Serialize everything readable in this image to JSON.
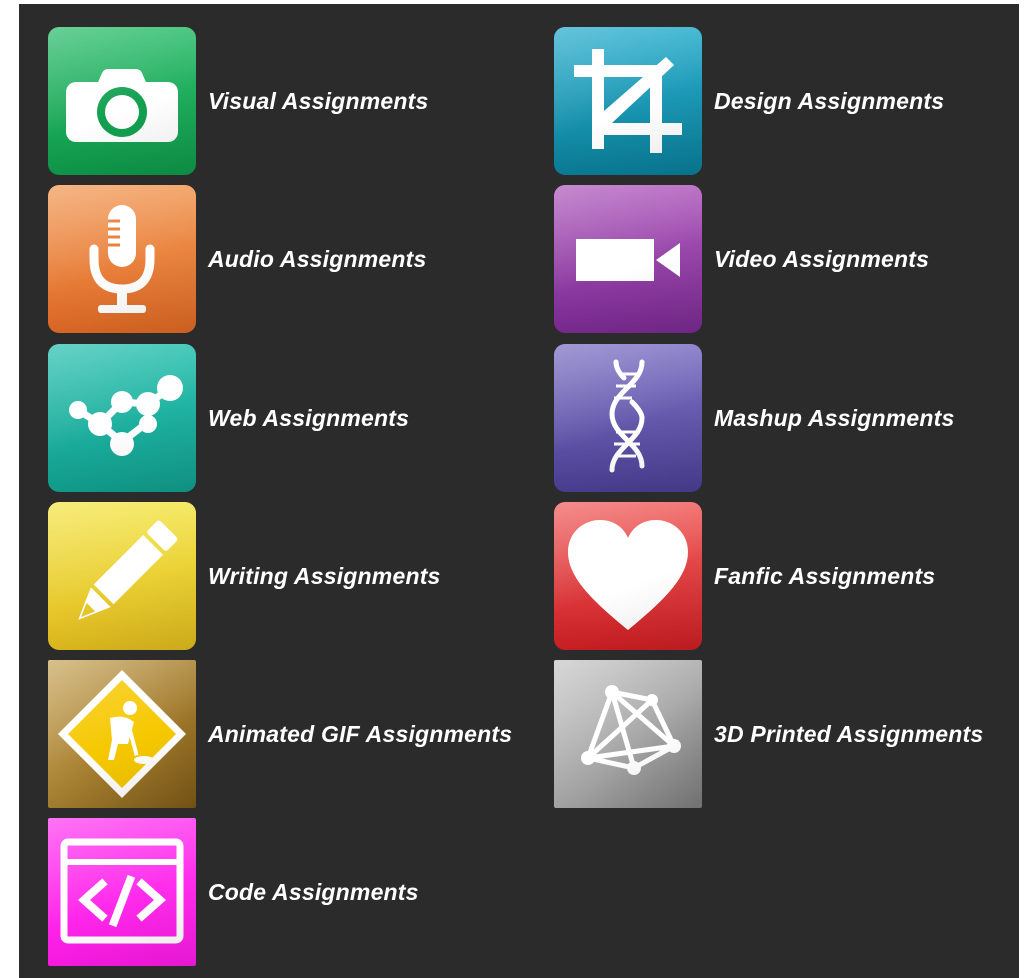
{
  "assignments": [
    {
      "label": "Visual Assignments",
      "icon": "camera-icon",
      "color": "#1aa65a"
    },
    {
      "label": "Design Assignments",
      "icon": "crop-icon",
      "color": "#1592b0"
    },
    {
      "label": "Audio Assignments",
      "icon": "microphone-icon",
      "color": "#ea7a34"
    },
    {
      "label": "Video Assignments",
      "icon": "video-camera-icon",
      "color": "#943aa8"
    },
    {
      "label": "Web Assignments",
      "icon": "network-icon",
      "color": "#1db3a2"
    },
    {
      "label": "Mashup Assignments",
      "icon": "dna-icon",
      "color": "#5f53ab"
    },
    {
      "label": "Writing Assignments",
      "icon": "pencil-icon",
      "color": "#ecd232"
    },
    {
      "label": "Fanfic Assignments",
      "icon": "heart-icon",
      "color": "#e0383a"
    },
    {
      "label": "Animated GIF Assignments",
      "icon": "construction-sign-icon",
      "color": "#a88330"
    },
    {
      "label": "3D Printed Assignments",
      "icon": "3d-wireframe-icon",
      "color": "#a5a5a5"
    },
    {
      "label": "Code Assignments",
      "icon": "code-window-icon",
      "color": "#ff2aec"
    }
  ]
}
